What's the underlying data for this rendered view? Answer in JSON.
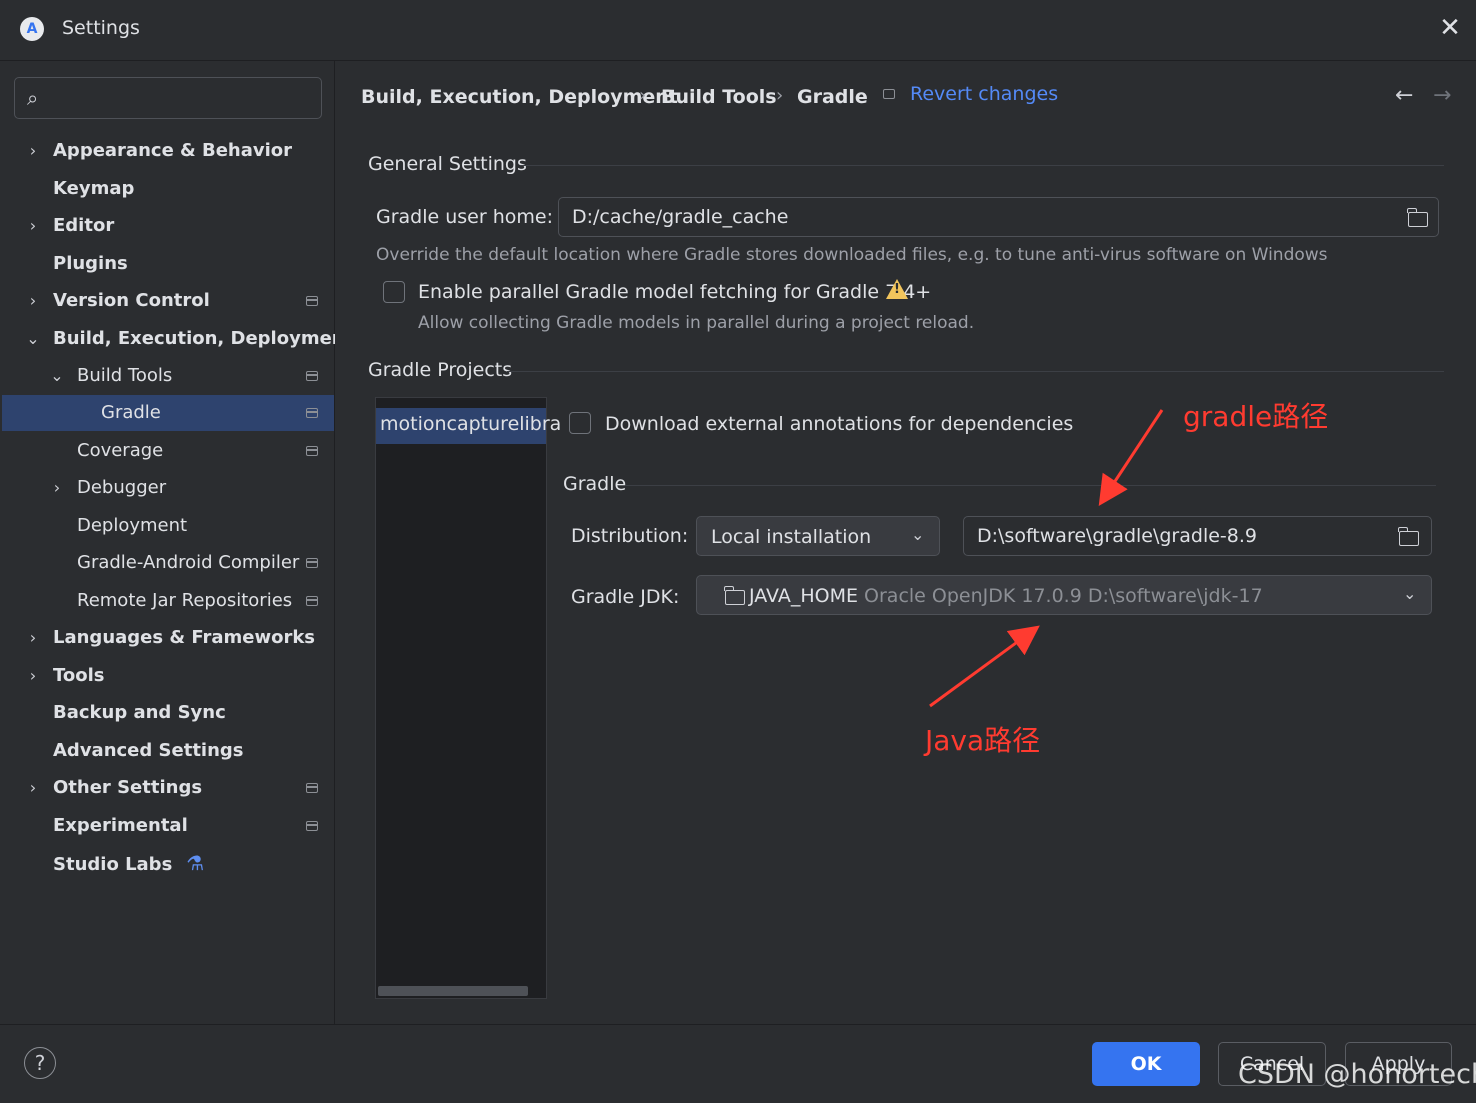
{
  "window": {
    "title": "Settings",
    "app_icon": "A"
  },
  "search": {
    "placeholder": ""
  },
  "sidebar": {
    "items": [
      {
        "label": "Appearance & Behavior"
      },
      {
        "label": "Keymap"
      },
      {
        "label": "Editor"
      },
      {
        "label": "Plugins"
      },
      {
        "label": "Version Control"
      },
      {
        "label": "Build, Execution, Deployment"
      },
      {
        "label": "Build Tools"
      },
      {
        "label": "Gradle"
      },
      {
        "label": "Coverage"
      },
      {
        "label": "Debugger"
      },
      {
        "label": "Deployment"
      },
      {
        "label": "Gradle-Android Compiler"
      },
      {
        "label": "Remote Jar Repositories"
      },
      {
        "label": "Languages & Frameworks"
      },
      {
        "label": "Tools"
      },
      {
        "label": "Backup and Sync"
      },
      {
        "label": "Advanced Settings"
      },
      {
        "label": "Other Settings"
      },
      {
        "label": "Experimental"
      },
      {
        "label": "Studio Labs"
      }
    ]
  },
  "breadcrumb": {
    "items": [
      "Build, Execution, Deployment",
      "Build Tools",
      "Gradle"
    ],
    "separator": "›",
    "revert": "Revert changes"
  },
  "general": {
    "title": "General Settings",
    "user_home_label": "Gradle user home:",
    "user_home_value": "D:/cache/gradle_cache",
    "user_home_hint": "Override the default location where Gradle stores downloaded files, e.g. to tune anti-virus software on Windows",
    "parallel_label": "Enable parallel Gradle model fetching for Gradle 7.4+",
    "parallel_hint": "Allow collecting Gradle models in parallel during a project reload."
  },
  "projects": {
    "title": "Gradle Projects",
    "list": [
      "motioncapturelibra"
    ],
    "download_annotations_label": "Download external annotations for dependencies",
    "gradle_section_title": "Gradle",
    "distribution_label": "Distribution:",
    "distribution_value": "Local installation",
    "distribution_path": "D:\\software\\gradle\\gradle-8.9",
    "jdk_label": "Gradle JDK:",
    "jdk_name": "JAVA_HOME",
    "jdk_detail": "Oracle OpenJDK 17.0.9 D:\\software\\jdk-17"
  },
  "annotations": {
    "gradle": "gradle路径",
    "java": "Java路径",
    "color": "#ff3b30"
  },
  "footer": {
    "help": "?",
    "ok": "OK",
    "cancel": "Cancel",
    "apply": "Apply"
  },
  "watermark": "CSDN @honortech",
  "colors": {
    "accent": "#3574f0",
    "link": "#548af7",
    "selection": "#2e436e",
    "background": "#2b2d30",
    "warning": "#f2c55c"
  }
}
